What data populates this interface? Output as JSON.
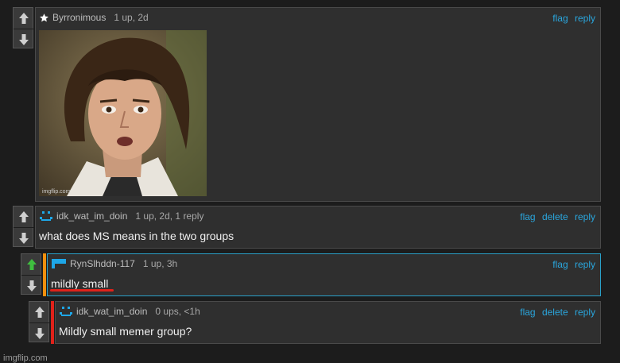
{
  "comments": [
    {
      "username": "Byrronimous",
      "meta": "1 up, 2d",
      "text": "",
      "actions": [
        "flag",
        "reply"
      ],
      "has_image": true
    },
    {
      "username": "idk_wat_im_doin",
      "meta": "1 up, 2d, 1 reply",
      "text": "what does MS means in the two groups",
      "actions": [
        "flag",
        "delete",
        "reply"
      ]
    },
    {
      "username": "RynSlhddn-117",
      "meta": "1 up, 3h",
      "text": "mildly small",
      "actions": [
        "flag",
        "reply"
      ],
      "upvoted": true
    },
    {
      "username": "idk_wat_im_doin",
      "meta": "0 ups, <1h",
      "text": "Mildly small memer group?",
      "actions": [
        "flag",
        "delete",
        "reply"
      ]
    }
  ],
  "meme_image": {
    "description_icon": "conspiracy-keanu-meme",
    "watermark": "imgflip.com"
  },
  "footer": {
    "watermark": "imgflip.com"
  },
  "colors": {
    "accent_link": "#2aa6dd",
    "upvote_active": "#3fbf3f",
    "stripe_orange": "#f0900e",
    "stripe_red": "#e0221a",
    "avatar_blue": "#1ea7e8"
  }
}
